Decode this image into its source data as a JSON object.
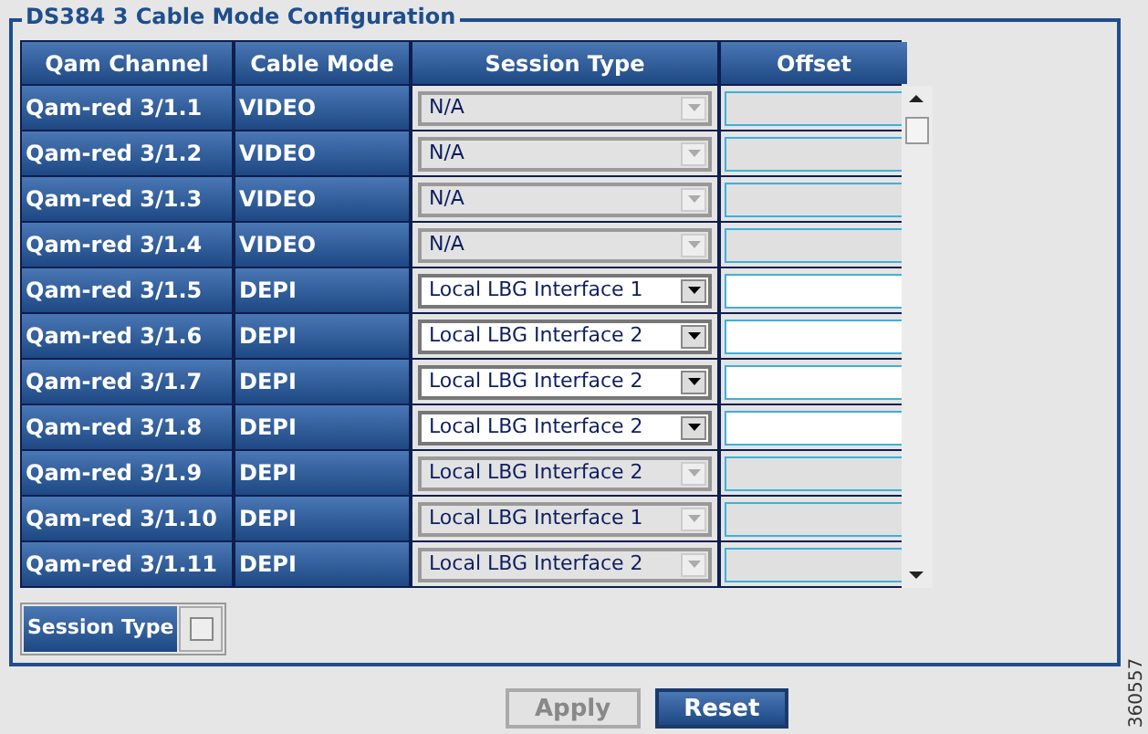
{
  "panel": {
    "title": "DS384 3 Cable Mode Configuration"
  },
  "table": {
    "columns": [
      "Qam Channel",
      "Cable Mode",
      "Session Type",
      "Offset"
    ],
    "rows": [
      {
        "channel": "Qam-red 3/1.1",
        "mode": "VIDEO",
        "session_type": "N/A",
        "disabled": true
      },
      {
        "channel": "Qam-red 3/1.2",
        "mode": "VIDEO",
        "session_type": "N/A",
        "disabled": true
      },
      {
        "channel": "Qam-red 3/1.3",
        "mode": "VIDEO",
        "session_type": "N/A",
        "disabled": true
      },
      {
        "channel": "Qam-red 3/1.4",
        "mode": "VIDEO",
        "session_type": "N/A",
        "disabled": true
      },
      {
        "channel": "Qam-red 3/1.5",
        "mode": "DEPI",
        "session_type": "Local LBG Interface 1",
        "disabled": false
      },
      {
        "channel": "Qam-red 3/1.6",
        "mode": "DEPI",
        "session_type": "Local LBG Interface 2",
        "disabled": false
      },
      {
        "channel": "Qam-red 3/1.7",
        "mode": "DEPI",
        "session_type": "Local LBG Interface 2",
        "disabled": false
      },
      {
        "channel": "Qam-red 3/1.8",
        "mode": "DEPI",
        "session_type": "Local LBG Interface 2",
        "disabled": false
      },
      {
        "channel": "Qam-red 3/1.9",
        "mode": "DEPI",
        "session_type": "Local LBG Interface 2",
        "disabled": true
      },
      {
        "channel": "Qam-red 3/1.10",
        "mode": "DEPI",
        "session_type": "Local LBG Interface 1",
        "disabled": true
      },
      {
        "channel": "Qam-red 3/1.11",
        "mode": "DEPI",
        "session_type": "Local LBG Interface 2",
        "disabled": true
      }
    ]
  },
  "session_type_toggle": {
    "label": "Session Type",
    "checked": false
  },
  "buttons": [
    {
      "label": "Apply",
      "disabled": true
    },
    {
      "label": "Reset",
      "disabled": false
    }
  ],
  "figure_id": "360557"
}
